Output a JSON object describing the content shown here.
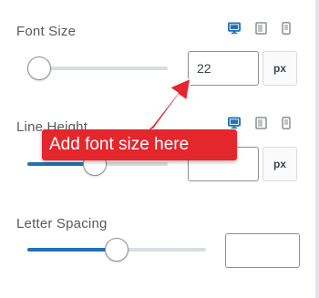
{
  "font_size": {
    "label": "Font Size",
    "value": "22",
    "unit": "px",
    "slider_level": 0.0
  },
  "line_height": {
    "label": "Line Height",
    "value": "",
    "unit": "px",
    "slider_level": 0.48
  },
  "letter_spacing": {
    "label": "Letter Spacing",
    "value": "",
    "slider_level": 0.5
  },
  "callout": {
    "text": "Add font size here"
  },
  "colors": {
    "accent": "#2271b1",
    "callout": "#e4262d"
  },
  "icons": [
    "desktop-icon",
    "tablet-icon",
    "mobile-icon"
  ]
}
